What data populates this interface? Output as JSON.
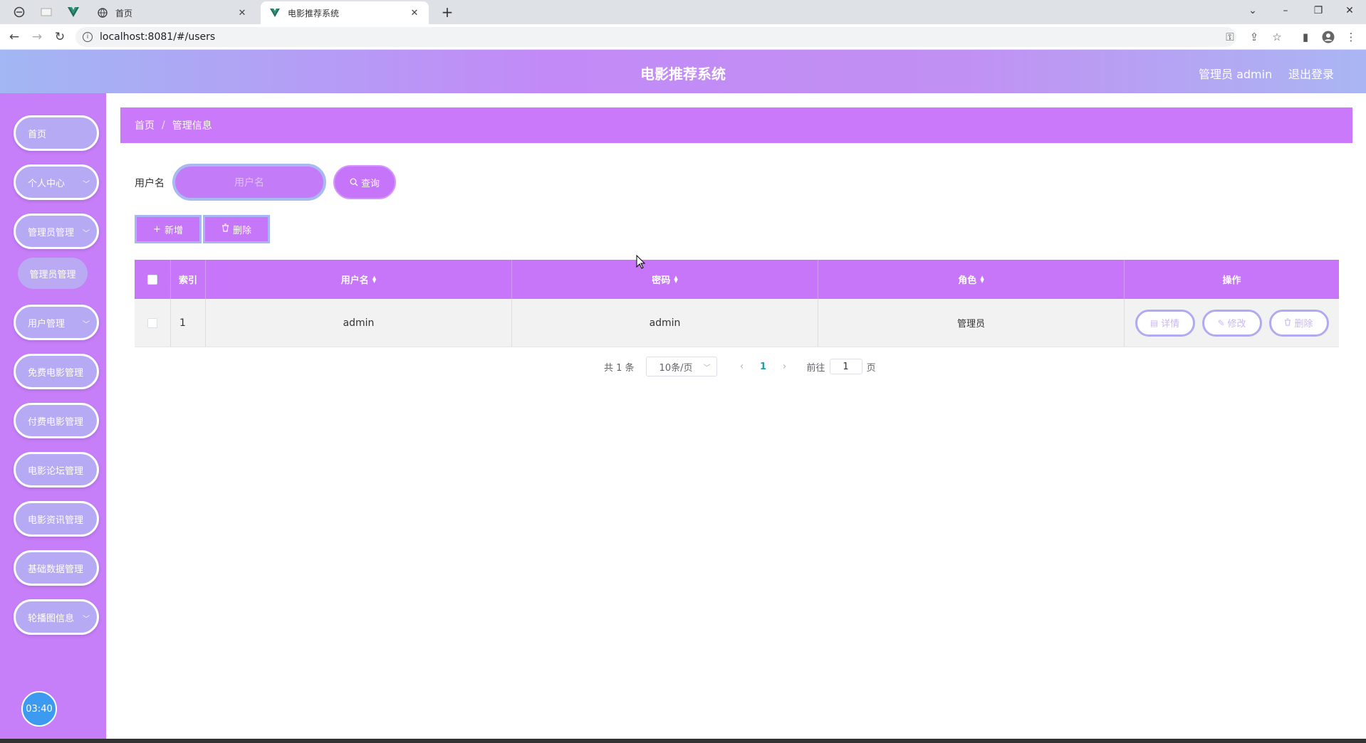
{
  "browser": {
    "tabs": [
      {
        "title": "首页",
        "active": false
      },
      {
        "title": "电影推荐系统",
        "active": true
      }
    ],
    "url": "localhost:8081/#/users"
  },
  "header": {
    "title": "电影推荐系统",
    "user": "管理员 admin",
    "logout": "退出登录"
  },
  "sidebar": {
    "items": [
      {
        "label": "首页",
        "has_chevron": false
      },
      {
        "label": "个人中心",
        "has_chevron": true
      },
      {
        "label": "管理员管理",
        "has_chevron": true
      },
      {
        "label": "用户管理",
        "has_chevron": true
      },
      {
        "label": "免费电影管理",
        "has_chevron": true
      },
      {
        "label": "付费电影管理",
        "has_chevron": true
      },
      {
        "label": "电影论坛管理",
        "has_chevron": true
      },
      {
        "label": "电影资讯管理",
        "has_chevron": true
      },
      {
        "label": "基础数据管理",
        "has_chevron": true
      },
      {
        "label": "轮播图信息",
        "has_chevron": true
      }
    ],
    "sub_item": "管理员管理",
    "clock": "03:40"
  },
  "breadcrumb": {
    "home": "首页",
    "sep": "/",
    "current": "管理信息"
  },
  "search": {
    "label": "用户名",
    "placeholder": "用户名",
    "button": "查询"
  },
  "actions": {
    "add": "新增",
    "delete": "删除"
  },
  "table": {
    "headers": {
      "index": "索引",
      "username": "用户名",
      "password": "密码",
      "role": "角色",
      "ops": "操作"
    },
    "rows": [
      {
        "index": "1",
        "username": "admin",
        "password": "admin",
        "role": "管理员"
      }
    ],
    "op_buttons": {
      "detail": "详情",
      "edit": "修改",
      "delete": "删除"
    }
  },
  "pagination": {
    "total": "共 1 条",
    "page_size": "10条/页",
    "current_page": "1",
    "goto_label": "前往",
    "goto_value": "1",
    "page_suffix": "页"
  },
  "colors": {
    "accent": "#c776f9",
    "header_gradient_left": "#a2b7f3",
    "header_gradient_mid": "#c28af7",
    "sidebar": "#c77ef9",
    "sidebar_button": "#b7aaf4"
  }
}
